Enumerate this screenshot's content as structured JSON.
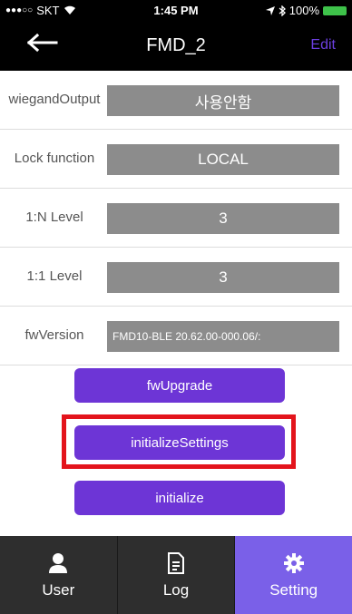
{
  "status": {
    "carrier": "SKT",
    "time": "1:45 PM",
    "battery": "100%"
  },
  "nav": {
    "back_icon": "back-arrow-icon",
    "title": "FMD_2",
    "edit_label": "Edit"
  },
  "rows": [
    {
      "label": "wiegandOutput",
      "value": "사용안함"
    },
    {
      "label": "Lock function",
      "value": "LOCAL"
    },
    {
      "label": "1:N Level",
      "value": "3"
    },
    {
      "label": "1:1 Level",
      "value": "3"
    },
    {
      "label": "fwVersion",
      "value": "FMD10-BLE 20.62.00-000.06/:"
    }
  ],
  "buttons": {
    "fw_upgrade": "fwUpgrade",
    "initialize_settings": "initializeSettings",
    "initialize": "initialize"
  },
  "tabs": [
    {
      "label": "User",
      "icon": "user-icon"
    },
    {
      "label": "Log",
      "icon": "document-icon"
    },
    {
      "label": "Setting",
      "icon": "gear-icon",
      "active": true
    }
  ],
  "colors": {
    "accent": "#6d35d6",
    "active_tab": "#7a60e8",
    "highlight": "#e3141c"
  }
}
